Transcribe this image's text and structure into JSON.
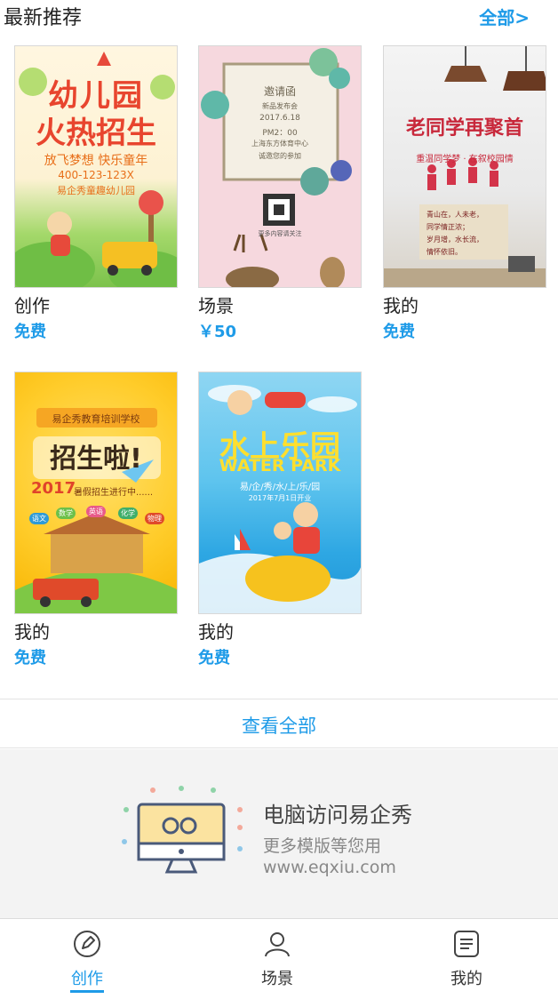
{
  "section": {
    "title": "最新推荐",
    "view_all_link": "全部>"
  },
  "templates": [
    {
      "name": "创作",
      "price": "免费",
      "poster_lines": [
        "幼儿园",
        "火热招生",
        "放飞梦想 快乐童年",
        "400-123-123X",
        "易企秀童趣幼儿园"
      ]
    },
    {
      "name": "场景",
      "price": "￥50",
      "poster_lines": [
        "邀请函",
        "新品发布会",
        "2017.6.18",
        "PM2：00",
        "上海东方体育中心",
        "诚邀您的参加",
        "更多内容请关注"
      ]
    },
    {
      "name": "我的",
      "price": "免费",
      "poster_lines": [
        "老同学再聚首",
        "重温同学梦 · 在叙校园情",
        "青山在，人未老，",
        "同学情正浓；",
        "岁月增，水长流，",
        "情怀依旧。"
      ]
    },
    {
      "name": "我的",
      "price": "免费",
      "poster_lines": [
        "易企秀教育培训学校",
        "招生啦!",
        "2017",
        "暑假招生进行中......",
        "语文",
        "数学",
        "英语",
        "化学",
        "物理"
      ]
    },
    {
      "name": "我的",
      "price": "免费",
      "poster_lines": [
        "水上乐园",
        "WATER PARK",
        "易/企/秀/水/上/乐/园",
        "2017年7月1日开业"
      ]
    }
  ],
  "view_all_button": "查看全部",
  "promo": {
    "title": "电脑访问易企秀",
    "subtitle": "更多模版等您用",
    "url": "www.eqxiu.com"
  },
  "tabbar": {
    "active": "创作",
    "items": [
      {
        "label": "创作",
        "icon": "pen-icon"
      },
      {
        "label": "场景",
        "icon": "person-icon"
      },
      {
        "label": "我的",
        "icon": "document-icon"
      }
    ]
  },
  "colors": {
    "accent": "#1e9be8",
    "text": "#222222",
    "muted": "#888888",
    "promo_bg": "#f3f3f3"
  }
}
